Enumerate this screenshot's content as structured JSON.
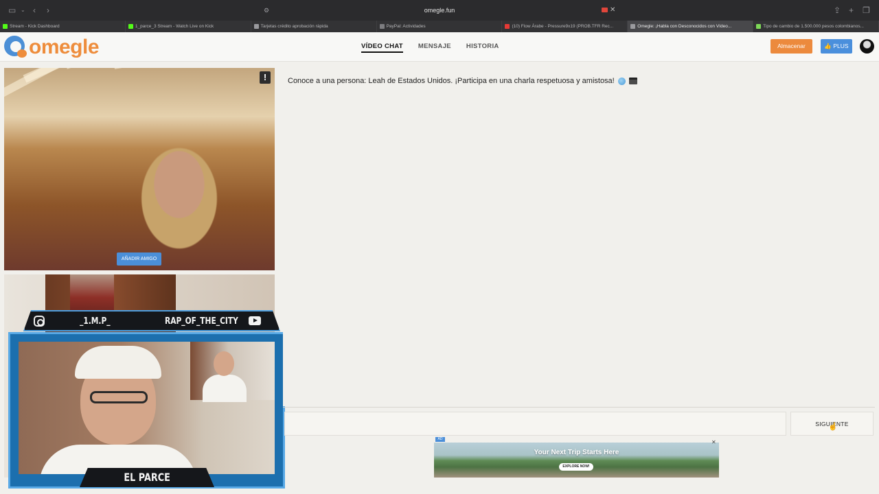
{
  "browser": {
    "url": "omegle.fun",
    "tabs": [
      {
        "label": "Stream - Kick Dashboard",
        "color": "#53fc18"
      },
      {
        "label": "1_parce_3 Stream - Watch Live on Kick",
        "color": "#53fc18"
      },
      {
        "label": "Tarjetas crédito aprobación rápida",
        "color": "#9a9a9e"
      },
      {
        "label": "PayPal: Actividades",
        "color": "#7d7d80"
      },
      {
        "label": "(10) Flow Árabe - Pressure9x19 (PROB.TFR Rec...",
        "color": "#e53935"
      },
      {
        "label": "Omegle: ¡Habla con Desconocidos con Vídeo...",
        "color": "#9a9a9e"
      },
      {
        "label": "Tipo de cambio de 1.500.000 pesos colombianos...",
        "color": "#7ed957"
      }
    ]
  },
  "header": {
    "logo_text": "omegle",
    "nav": {
      "video_chat": "VÍDEO CHAT",
      "message": "MENSAJE",
      "history": "HISTORIA"
    },
    "store_label": "Almacenar",
    "plus_label": "PLUS"
  },
  "stranger": {
    "report_label": "!",
    "add_friend_label": "AÑADIR AMIGO"
  },
  "overlay": {
    "instagram_handle": "_1.M.P_",
    "youtube_handle": "RAP_OF_THE_CITY",
    "name": "EL PARCE"
  },
  "chat": {
    "message": "Conoce a una persona: Leah de Estados Unidos. ¡Participa en una charla respetuosa y amistosa!",
    "input_value": "",
    "next_label": "SIGUIENTE"
  },
  "ad": {
    "badge": "AD",
    "headline": "Your Next Trip Starts Here",
    "cta": "EXPLORE NOW!"
  },
  "colors": {
    "brand_orange": "#ee8d3c",
    "brand_blue": "#4b8fd6",
    "overlay_frame": "#58a9e6"
  }
}
